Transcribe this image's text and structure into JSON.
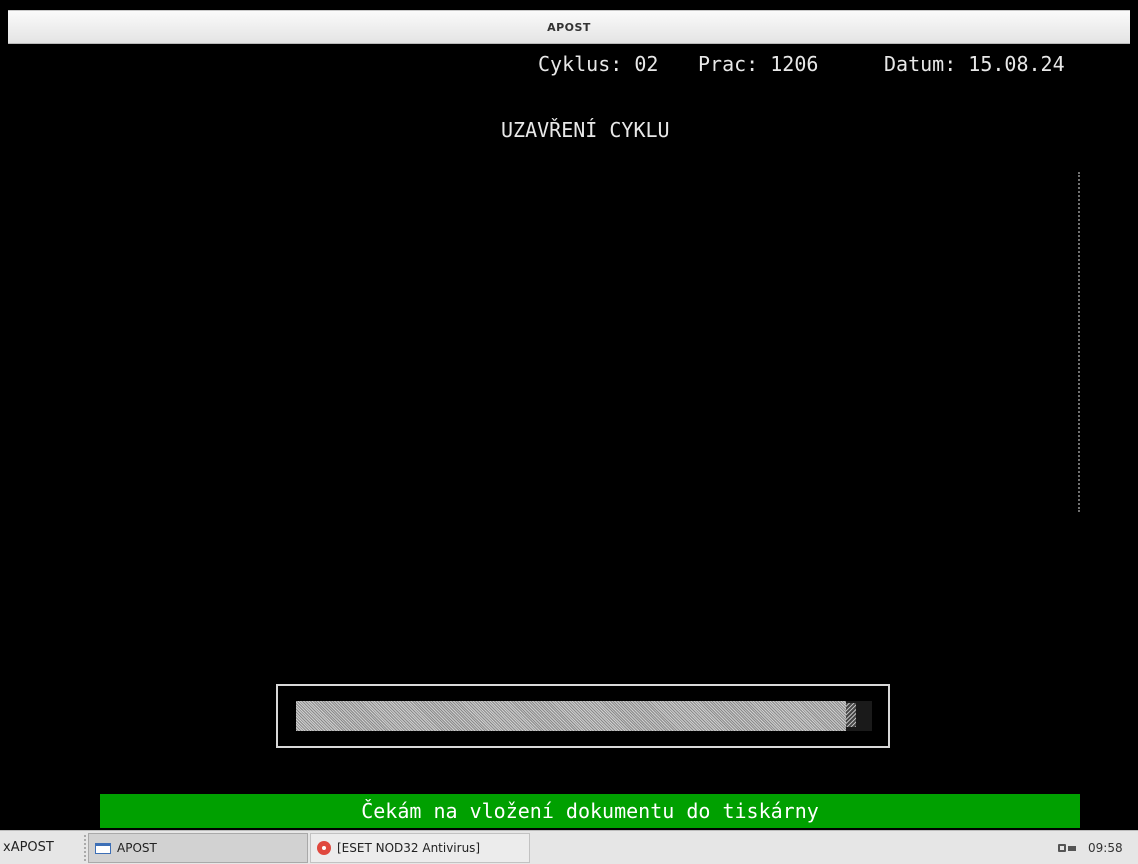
{
  "window": {
    "title": "APOST"
  },
  "terminal": {
    "header": {
      "cyklus": "Cyklus: 02",
      "prac": "Prac: 1206",
      "datum": "Datum: 15.08.24"
    },
    "screen_title": "UZAVŘENÍ CYKLU",
    "progress": {
      "fraction": 0.98
    },
    "status_message": "Čekám na vložení dokumentu do tiskárny"
  },
  "taskbar": {
    "start_label": "xAPOST",
    "tasks": [
      {
        "label": "APOST",
        "icon": "window-icon"
      },
      {
        "label": "[ESET NOD32 Antivirus]",
        "icon": "eset-icon"
      }
    ],
    "tray": {
      "network_icon": "network-icon",
      "clock": "09:58"
    }
  }
}
